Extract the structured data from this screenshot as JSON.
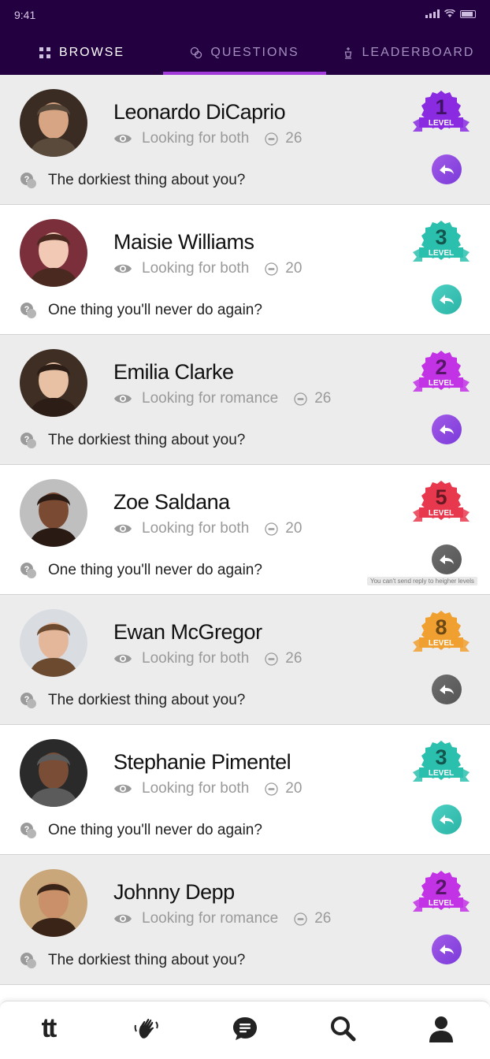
{
  "status": {
    "time": "9:41"
  },
  "tabs": [
    {
      "label": "BROWSE",
      "icon": "grid-icon",
      "active": false
    },
    {
      "label": "QUESTIONS",
      "icon": "chat-bubbles-icon",
      "active": true
    },
    {
      "label": "LEADERBOARD",
      "icon": "chess-king-icon",
      "active": false
    }
  ],
  "level_word": "LEVEL",
  "level_colors": {
    "1": "#8a2be2",
    "2": "#c233e6",
    "3": "#2bbfae",
    "5": "#e8384e",
    "8": "#f0a030"
  },
  "cards": [
    {
      "name": "Leonardo DiCaprio",
      "looking": "Looking for both",
      "age": "26",
      "question": "The dorkiest thing about you?",
      "level": "1",
      "reply": "purple"
    },
    {
      "name": "Maisie Williams",
      "looking": "Looking for both",
      "age": "20",
      "question": "One thing you'll never do again?",
      "level": "3",
      "reply": "teal"
    },
    {
      "name": "Emilia Clarke",
      "looking": "Looking for romance",
      "age": "26",
      "question": "The dorkiest thing about you?",
      "level": "2",
      "reply": "purple"
    },
    {
      "name": "Zoe Saldana",
      "looking": "Looking for both",
      "age": "20",
      "question": "One thing you'll never do again?",
      "level": "5",
      "reply": "grey",
      "tooltip": "You can't send reply to heigher levels"
    },
    {
      "name": "Ewan McGregor",
      "looking": "Looking for both",
      "age": "26",
      "question": "The dorkiest thing about you?",
      "level": "8",
      "reply": "grey"
    },
    {
      "name": "Stephanie Pimentel",
      "looking": "Looking for both",
      "age": "20",
      "question": "One thing you'll never do again?",
      "level": "3",
      "reply": "teal"
    },
    {
      "name": "Johnny Depp",
      "looking": "Looking for romance",
      "age": "26",
      "question": "The dorkiest thing about you?",
      "level": "2",
      "reply": "purple"
    }
  ],
  "bottom_nav": {
    "home_label": "tt",
    "items": [
      "home-logo-icon",
      "wave-hand-icon",
      "messages-icon",
      "search-icon",
      "profile-icon"
    ]
  }
}
